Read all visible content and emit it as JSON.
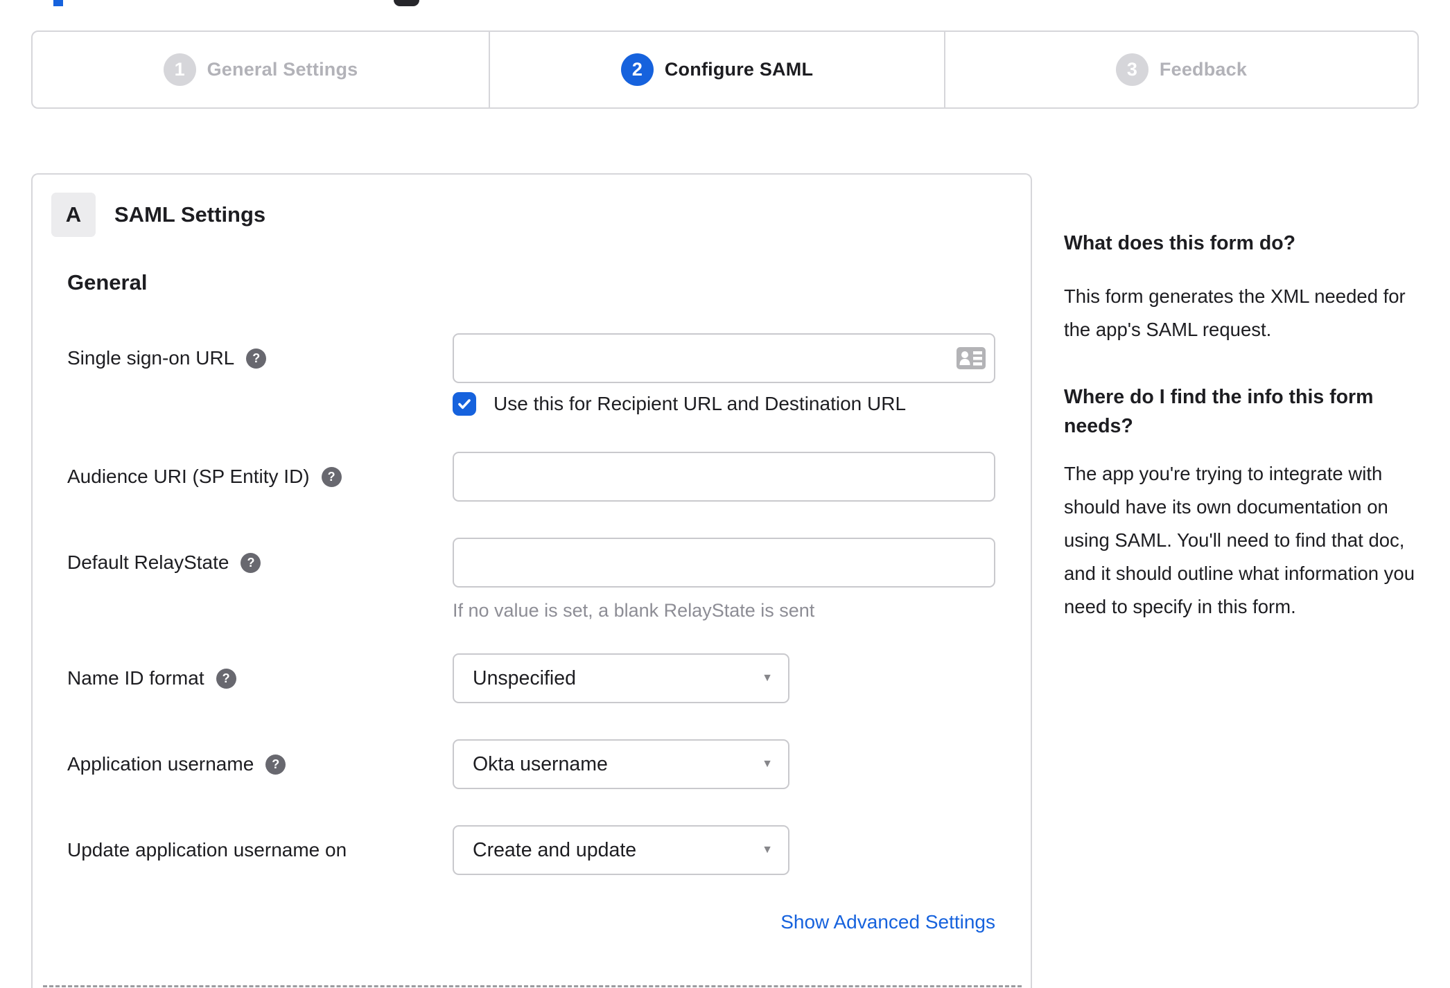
{
  "stepper": {
    "steps": [
      {
        "number": "1",
        "label": "General Settings",
        "state": "inactive"
      },
      {
        "number": "2",
        "label": "Configure SAML",
        "state": "active"
      },
      {
        "number": "3",
        "label": "Feedback",
        "state": "inactive"
      }
    ]
  },
  "panel": {
    "section_badge": "A",
    "section_title": "SAML Settings",
    "group_title": "General",
    "fields": {
      "sso_url": {
        "label": "Single sign-on URL",
        "value": ""
      },
      "sso_checkbox": {
        "label": "Use this for Recipient URL and Destination URL",
        "checked": true
      },
      "audience_uri": {
        "label": "Audience URI (SP Entity ID)",
        "value": ""
      },
      "default_relaystate": {
        "label": "Default RelayState",
        "value": "",
        "helper": "If no value is set, a blank RelayState is sent"
      },
      "name_id_format": {
        "label": "Name ID format",
        "value": "Unspecified"
      },
      "app_username": {
        "label": "Application username",
        "value": "Okta username"
      },
      "update_app_username": {
        "label": "Update application username on",
        "value": "Create and update"
      }
    },
    "advanced_link": "Show Advanced Settings"
  },
  "sidebar": {
    "sections": [
      {
        "heading": "What does this form do?",
        "body": "This form generates the XML needed for the app's SAML request."
      },
      {
        "heading": "Where do I find the info this form needs?",
        "body": "The app you're trying to integrate with should have its own documentation on using SAML. You'll need to find that doc, and it should outline what information you need to specify in this form."
      }
    ]
  },
  "icons": {
    "help_glyph": "?",
    "dropdown_arrow": "▼"
  },
  "colors": {
    "accent_blue": "#1662dd",
    "inactive_gray": "#d6d6da",
    "text_dark": "#1d1d21",
    "helper_gray": "#8d8d95",
    "border_gray": "#c9c9cd"
  }
}
